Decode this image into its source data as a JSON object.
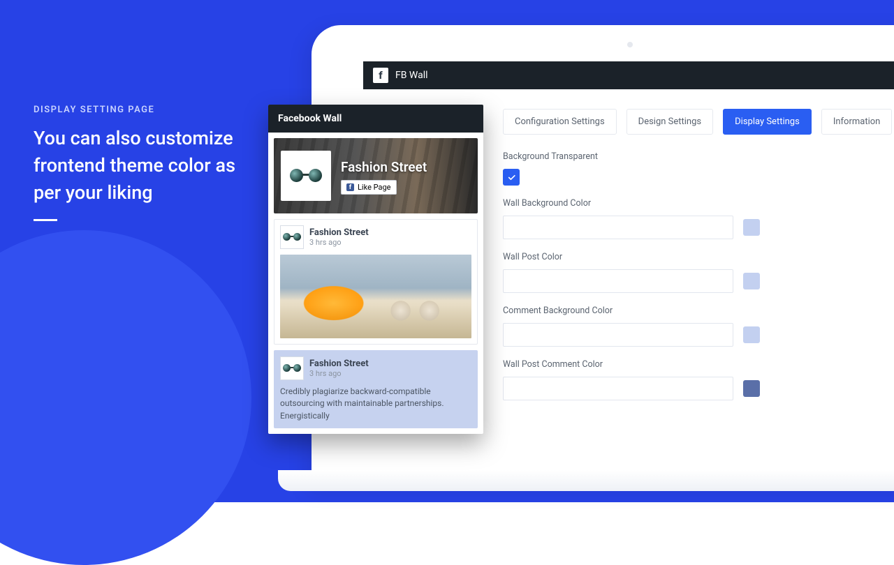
{
  "promo": {
    "kicker": "DISPLAY SETTING PAGE",
    "headline": "You can also customize frontend theme color as per your liking"
  },
  "admin": {
    "app_title": "FB Wall",
    "tabs": [
      {
        "label": "Configuration Settings"
      },
      {
        "label": "Design Settings"
      },
      {
        "label": "Display Settings"
      },
      {
        "label": "Information"
      }
    ],
    "fields": {
      "bg_transparent_label": "Background Transparent",
      "wall_bg_label": "Wall Background Color",
      "wall_post_label": "Wall Post Color",
      "comment_bg_label": "Comment Background Color",
      "wall_post_comment_label": "Wall Post Comment Color"
    },
    "colors": {
      "wall_bg_swatch": "#c3d0f0",
      "wall_post_swatch": "#c3d0f0",
      "comment_bg_swatch": "#c3d0f0",
      "wall_post_comment_swatch": "#5a6fa8"
    }
  },
  "preview": {
    "title": "Facebook Wall",
    "page_name": "Fashion Street",
    "like_label": "Like Page",
    "posts": [
      {
        "name": "Fashion Street",
        "time": "3 hrs ago"
      },
      {
        "name": "Fashion Street",
        "time": "3 hrs ago",
        "text": "Credibly plagiarize backward-compatible outsourcing with maintainable partnerships. Energistically"
      }
    ]
  }
}
